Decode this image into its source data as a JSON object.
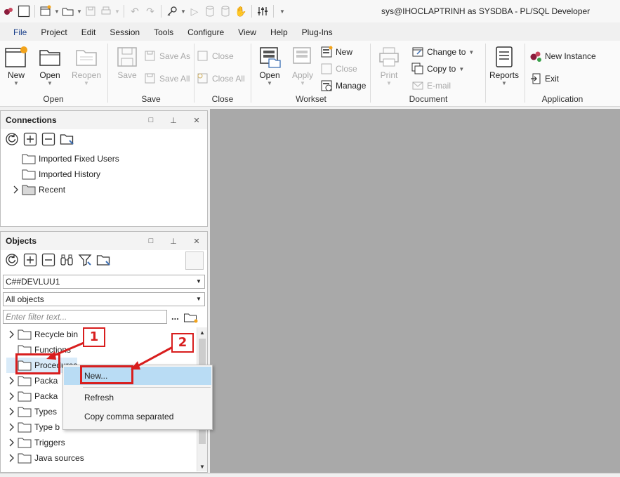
{
  "window": {
    "title": "sys@IHOCLAPTRINH as SYSDBA - PL/SQL Developer"
  },
  "menu": [
    "File",
    "Project",
    "Edit",
    "Session",
    "Tools",
    "Configure",
    "View",
    "Help",
    "Plug-Ins"
  ],
  "ribbon": {
    "open_group": {
      "label": "Open",
      "new": "New",
      "open": "Open",
      "reopen": "Reopen"
    },
    "save_group": {
      "label": "Save",
      "save": "Save",
      "save_as": "Save As",
      "save_all": "Save All"
    },
    "close_group": {
      "label": "Close",
      "close": "Close",
      "close_all": "Close All"
    },
    "worksheet_group": {
      "label": "Workset",
      "open": "Open",
      "apply": "Apply",
      "new": "New",
      "close": "Close",
      "manage": "Manage"
    },
    "document_group": {
      "label": "Document",
      "print": "Print",
      "change_to": "Change to",
      "copy_to": "Copy to",
      "email": "E-mail"
    },
    "reports": "Reports",
    "application_group": {
      "label": "Application",
      "new_instance": "New Instance",
      "exit": "Exit"
    }
  },
  "connections": {
    "title": "Connections",
    "items": [
      "Imported Fixed Users",
      "Imported History",
      "Recent"
    ]
  },
  "objects": {
    "title": "Objects",
    "user": "C##DEVLUU1",
    "filter_type": "All objects",
    "filter_placeholder": "Enter filter text...",
    "ellipsis": "...",
    "items": [
      "Recycle bin",
      "Functions",
      "Procedures",
      "Packa",
      "Packa",
      "Types",
      "Type b",
      "Triggers",
      "Java sources"
    ]
  },
  "context_menu": {
    "new": "New...",
    "refresh": "Refresh",
    "copy": "Copy comma separated"
  },
  "annotations": {
    "one": "1",
    "two": "2"
  },
  "colors": {
    "annotation": "#d81e1e",
    "highlight": "#b9dcf4",
    "workspace": "#a9a9a9"
  }
}
